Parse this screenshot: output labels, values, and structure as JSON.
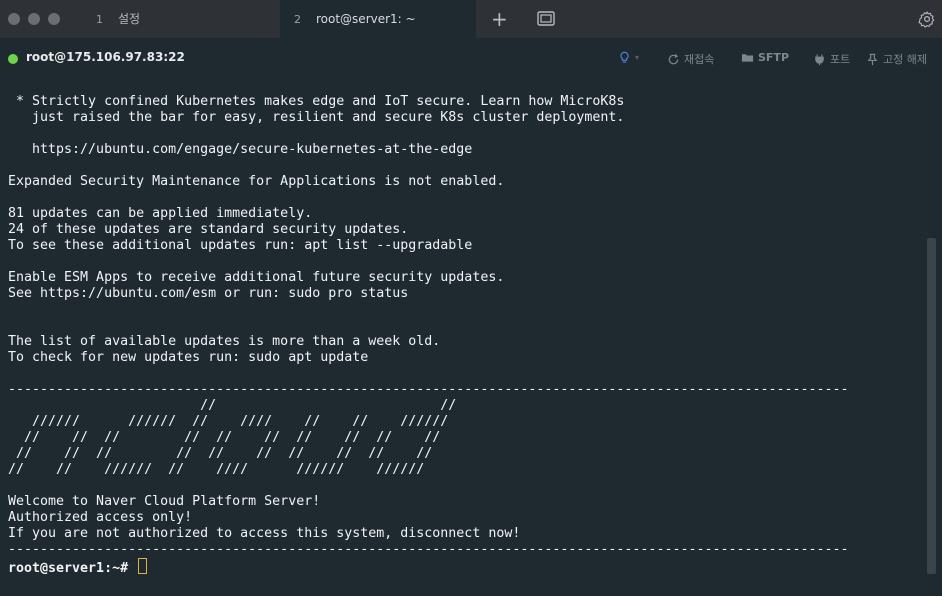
{
  "titlebar": {
    "tabs": [
      {
        "index": "1",
        "label": "설정"
      },
      {
        "index": "2",
        "label": "root@server1: ~"
      }
    ],
    "new_tab_label": "+"
  },
  "infobar": {
    "connection": "root@175.106.97.83:22",
    "status_color": "#6fd34e",
    "tools": {
      "reconnect": "재접속",
      "sftp": "SFTP",
      "port": "포트",
      "pin": "고정 해제"
    }
  },
  "terminal": {
    "output": " * Strictly confined Kubernetes makes edge and IoT secure. Learn how MicroK8s\n   just raised the bar for easy, resilient and secure K8s cluster deployment.\n\n   https://ubuntu.com/engage/secure-kubernetes-at-the-edge\n\nExpanded Security Maintenance for Applications is not enabled.\n\n81 updates can be applied immediately.\n24 of these updates are standard security updates.\nTo see these additional updates run: apt list --upgradable\n\nEnable ESM Apps to receive additional future security updates.\nSee https://ubuntu.com/esm or run: sudo pro status\n\n\nThe list of available updates is more than a week old.\nTo check for new updates run: sudo apt update\n\n---------------------------------------------------------------------------------------------------------\n                        //                            //\n   //////      //////  //    ////    //    //    //////\n  //    //  //        //  //    //  //    //  //    //\n //    //  //        //  //    //  //    //  //    //\n//    //    //////  //    ////      //////    //////\n\nWelcome to Naver Cloud Platform Server!\nAuthorized access only!\nIf you are not authorized to access this system, disconnect now!\n---------------------------------------------------------------------------------------------------------",
    "prompt": "root@server1:~#"
  }
}
